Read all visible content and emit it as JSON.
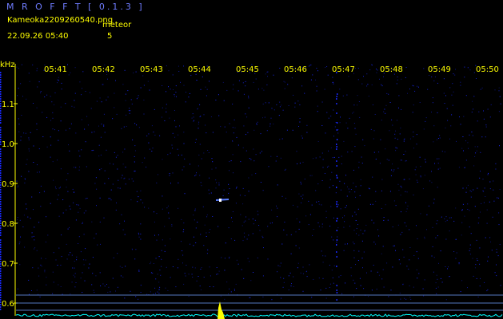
{
  "app_title": "M R O F F T  [ 0.1.3 ]",
  "filename": "Kameoka2209260540.png",
  "datetime": "22.09.26  05:40",
  "meteor_label": "meteor",
  "meteor_count": "5",
  "freq_unit": "kHz",
  "freq_ticks": [
    "1.1",
    "1.0",
    "0.9",
    "0.8",
    "0.7",
    "0.6"
  ],
  "time_ticks": [
    "05:41",
    "05:42",
    "05:43",
    "05:44",
    "05:45",
    "05:46",
    "05:47",
    "05:48",
    "05:49",
    "05:50"
  ],
  "colors": {
    "background": "#000000",
    "text": "#ffff00",
    "title": "#6f7cff",
    "noise": "#1a2aff",
    "line": "#6fa0ff",
    "level": "#00ffff",
    "peak": "#ffff00"
  }
}
